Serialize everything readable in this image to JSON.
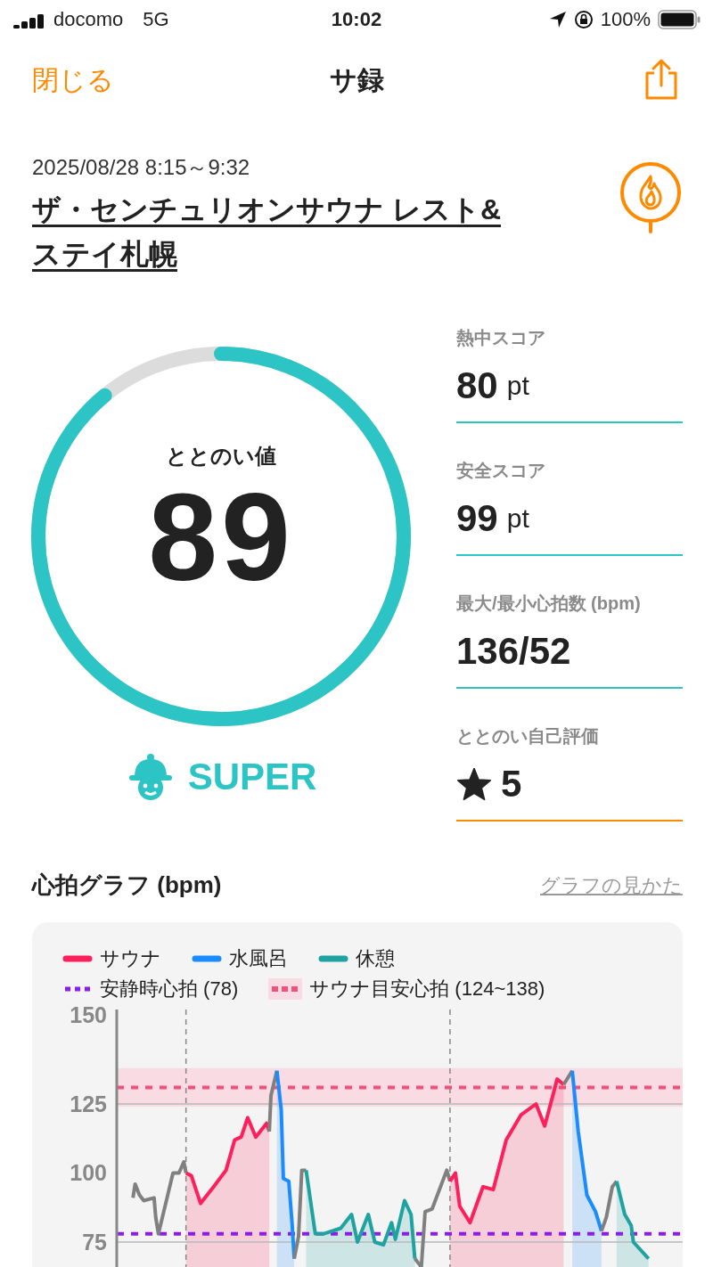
{
  "status_bar": {
    "carrier": "docomo",
    "network": "5G",
    "time": "10:02",
    "battery": "100%"
  },
  "nav": {
    "close": "閉じる",
    "title": "サ録"
  },
  "session": {
    "datetime": "2025/08/28 8:15～9:32",
    "facility": "ザ・センチュリオンサウナ レスト&ステイ札幌"
  },
  "score": {
    "label": "ととのい値",
    "value": "89",
    "rank": "SUPER"
  },
  "metrics": [
    {
      "label": "熱中スコア",
      "value": "80",
      "unit": "pt",
      "kind": "score"
    },
    {
      "label": "安全スコア",
      "value": "99",
      "unit": "pt",
      "kind": "score"
    },
    {
      "label": "最大/最小心拍数 (bpm)",
      "value": "136/52",
      "kind": "score"
    },
    {
      "label": "ととのい自己評価",
      "value": "5",
      "kind": "rating"
    }
  ],
  "heart_graph": {
    "title": "心拍グラフ (bpm)",
    "help_link": "グラフの見かた",
    "legend": [
      {
        "label": "サウナ",
        "color": "#ff1f5a",
        "kind": "solid"
      },
      {
        "label": "水風呂",
        "color": "#1a8cff",
        "kind": "solid"
      },
      {
        "label": "休憩",
        "color": "#1fa3a0",
        "kind": "solid"
      },
      {
        "label": "安静時心拍 (78)",
        "color": "#8a1cf0",
        "kind": "dotted"
      },
      {
        "label": "サウナ目安心拍 (124~138)",
        "color": "#f0507a",
        "kind": "band"
      }
    ],
    "y_labels": [
      "150",
      "125",
      "100",
      "75"
    ]
  }
}
